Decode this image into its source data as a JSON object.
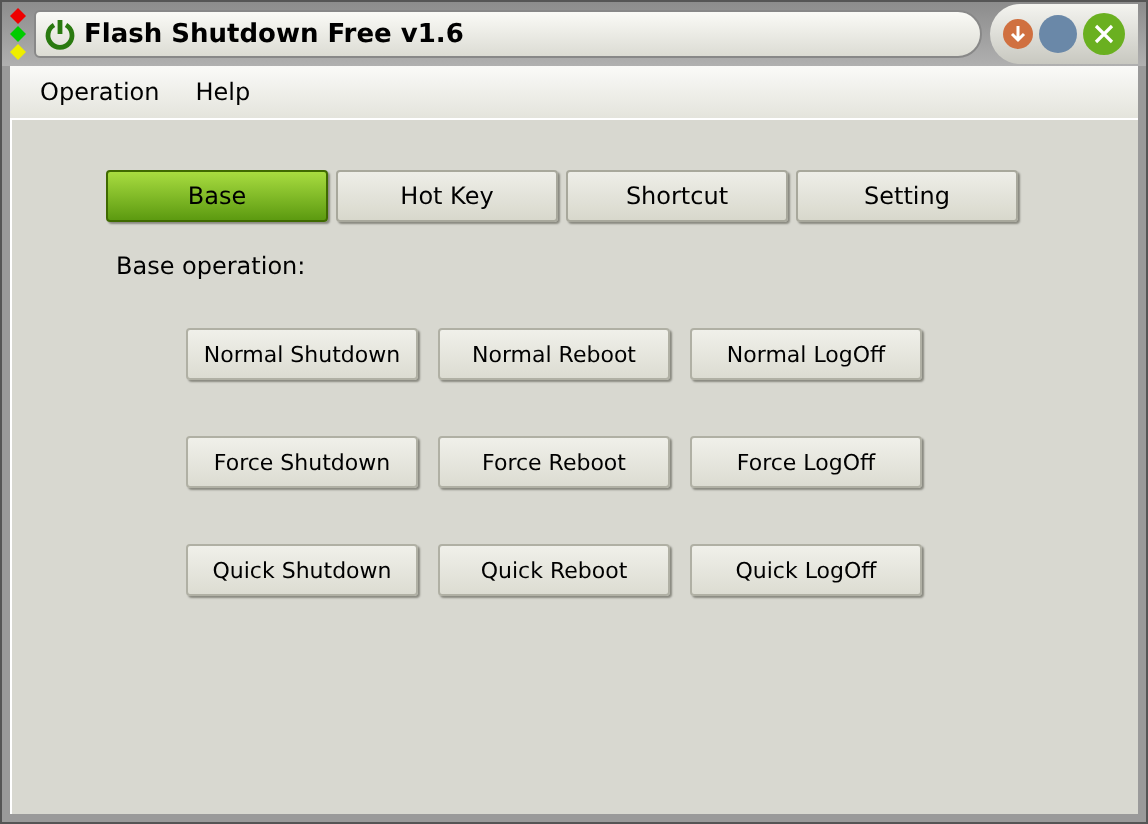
{
  "window": {
    "title": "Flash Shutdown Free v1.6"
  },
  "menu": [
    "Operation",
    "Help"
  ],
  "tabs": [
    {
      "label": "Base",
      "selected": true
    },
    {
      "label": "Hot Key",
      "selected": false
    },
    {
      "label": "Shortcut",
      "selected": false
    },
    {
      "label": "Setting",
      "selected": false
    }
  ],
  "section_label": "Base operation:",
  "button_rows": [
    [
      "Normal Shutdown",
      "Normal Reboot",
      "Normal LogOff"
    ],
    [
      "Force Shutdown",
      "Force Reboot",
      "Force LogOff"
    ],
    [
      "Quick Shutdown",
      "Quick Reboot",
      "Quick LogOff"
    ]
  ]
}
